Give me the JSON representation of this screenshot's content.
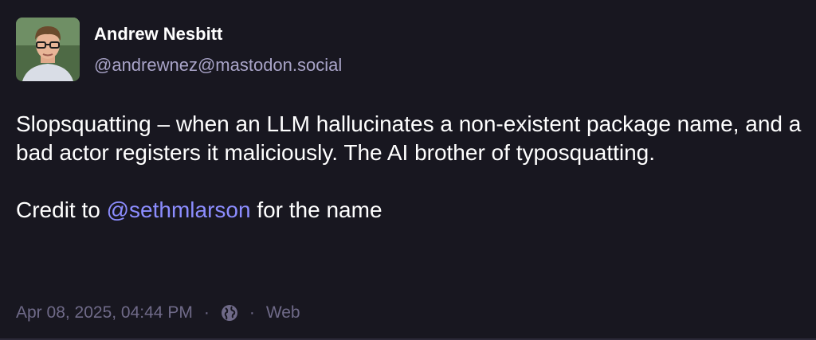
{
  "post": {
    "author": {
      "display_name": "Andrew Nesbitt",
      "handle": "@andrewnez@mastodon.social",
      "avatar_icon": "user-photo-avatar"
    },
    "content": {
      "paragraph_1": "Slopsquatting – when an LLM hallucinates a non-existent package name, and a bad actor registers it maliciously. The AI brother of typosquatting.",
      "paragraph_2_prefix": "Credit to ",
      "paragraph_2_mention": "@sethmlarson",
      "paragraph_2_suffix": " for the name"
    },
    "meta": {
      "timestamp": "Apr 08, 2025, 04:44 PM",
      "separator": "·",
      "visibility_icon": "globe-icon",
      "application": "Web"
    },
    "colors": {
      "background": "#181720",
      "text": "#ffffff",
      "handle": "#a8a3c7",
      "mention": "#8c8dff",
      "meta": "#6f6a88"
    }
  }
}
